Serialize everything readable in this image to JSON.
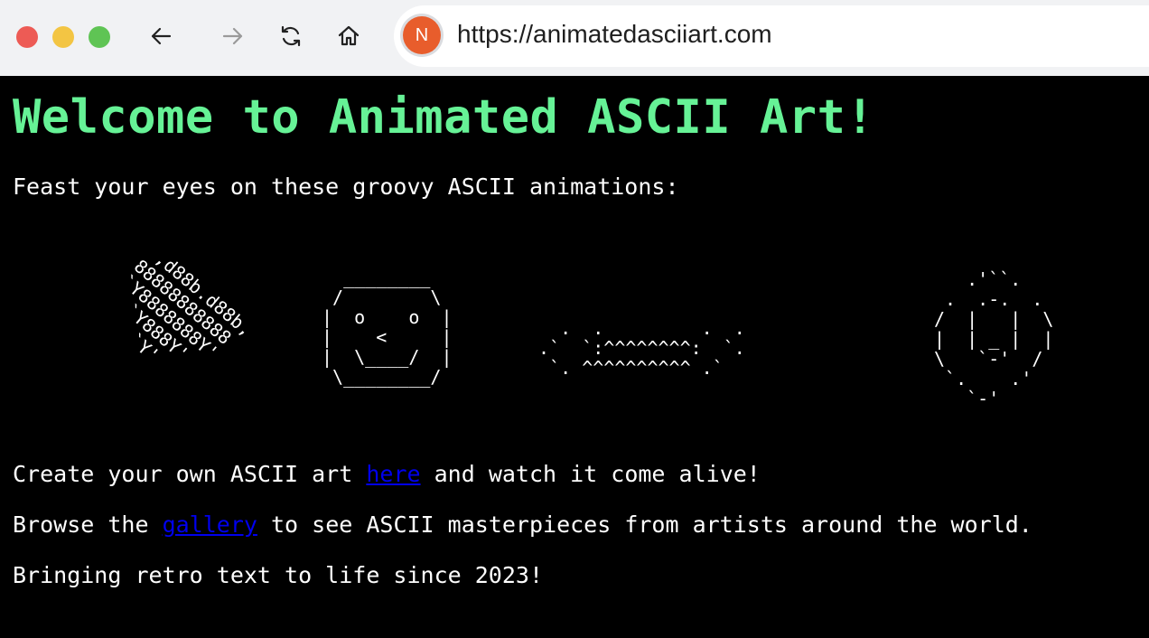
{
  "browser": {
    "url": "https://animatedasciiart.com",
    "profile_initial": "N",
    "icons": [
      "back-arrow-icon",
      "forward-arrow-icon",
      "reload-icon",
      "home-icon"
    ],
    "colors": {
      "close": "#ed5b55",
      "minimize": "#f3c543",
      "maximize": "#5fc454",
      "avatar": "#e85d2c"
    }
  },
  "page": {
    "title": "Welcome to Animated ASCII Art!",
    "intro": "Feast your eyes on these groovy ASCII animations:",
    "ascii": {
      "heart": "  ,d88b.d88b,\n 88888888888\n `Y8888888Y'\n   `Y888Y'\n     `Y'",
      "face": "  ________\n /        \\\n|  o    o  |\n|    <     |\n|  \\____/  |\n \\________/",
      "wave": "   .  .         .  .\n .`  `:^^^^^^^^:  `.\n  `. ^^^^^^^^^^ .`",
      "smiley": "   .'``.\n .  .-.  .\n/  |   |  \\\n|  | _ |  |\n\\   `-'  /\n `.    .'\n   `-'"
    },
    "create": {
      "before": "Create your own ASCII art ",
      "link": "here",
      "after": " and watch it come alive!"
    },
    "browse": {
      "before": "Browse the ",
      "link": "gallery",
      "after": " to see ASCII masterpieces from artists around the world."
    },
    "tagline": "Bringing retro text to life since 2023!",
    "colors": {
      "title": "#66f296",
      "link": "#0000ee",
      "background": "#000000"
    }
  }
}
